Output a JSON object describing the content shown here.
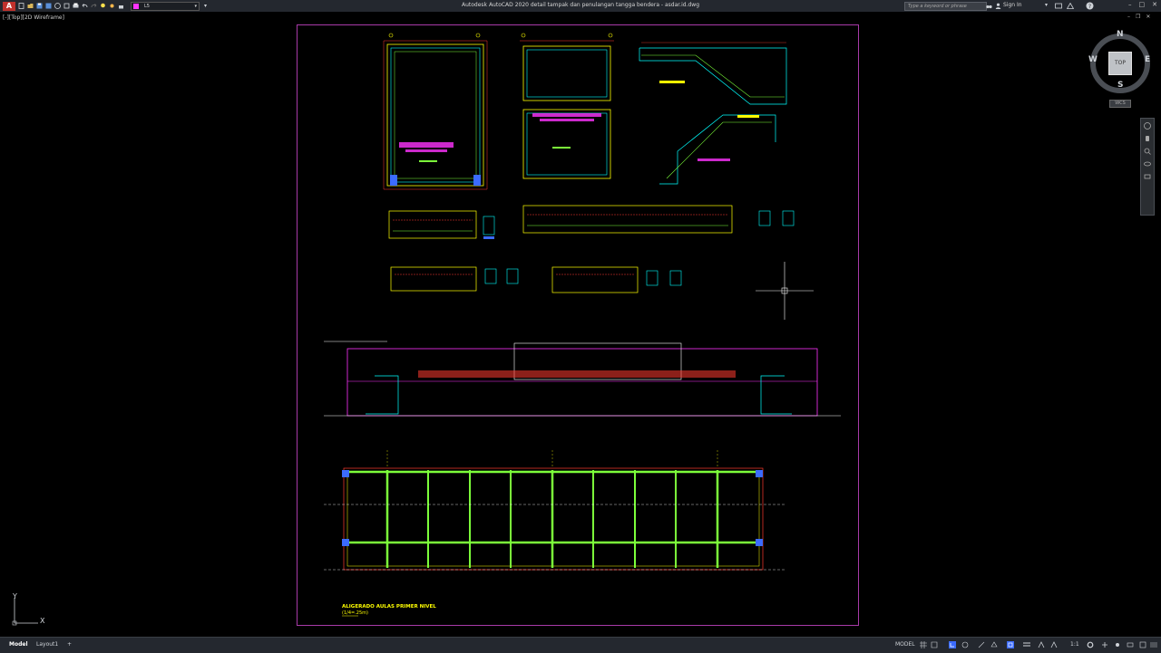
{
  "titlebar": {
    "app_title": "Autodesk AutoCAD 2020    detail tampak dan penulangan tangga bendera - asdar.id.dwg",
    "app_icon_label": "A",
    "layer_current": "L5",
    "search_placeholder": "Type a keyword or phrase",
    "sign_in": "Sign In"
  },
  "viewport": {
    "label": "[-][Top][2D Wireframe]"
  },
  "viewcube": {
    "north": "N",
    "south": "S",
    "east": "E",
    "west": "W",
    "face": "TOP",
    "wcs": "WCS"
  },
  "ucs": {
    "x": "X",
    "y": "Y"
  },
  "drawing": {
    "plan_title": "ALIGERADO AULAS PRIMER NIVEL",
    "plan_scale": "(1/4=.25m)"
  },
  "statusbar": {
    "tabs": [
      "Model",
      "Layout1"
    ],
    "add_tab": "+",
    "model_button": "MODEL",
    "scale": "1:1"
  },
  "colors": {
    "titlebar": "#24282f",
    "canvas": "#000000",
    "sheet_border": "#a83aa8",
    "cad_yellow": "#ffff00",
    "cad_green": "#7cff3a",
    "cad_cyan": "#00ffff",
    "cad_magenta": "#ff33ff",
    "cad_red": "#ff3b2f",
    "cad_blue": "#3b6bff"
  }
}
